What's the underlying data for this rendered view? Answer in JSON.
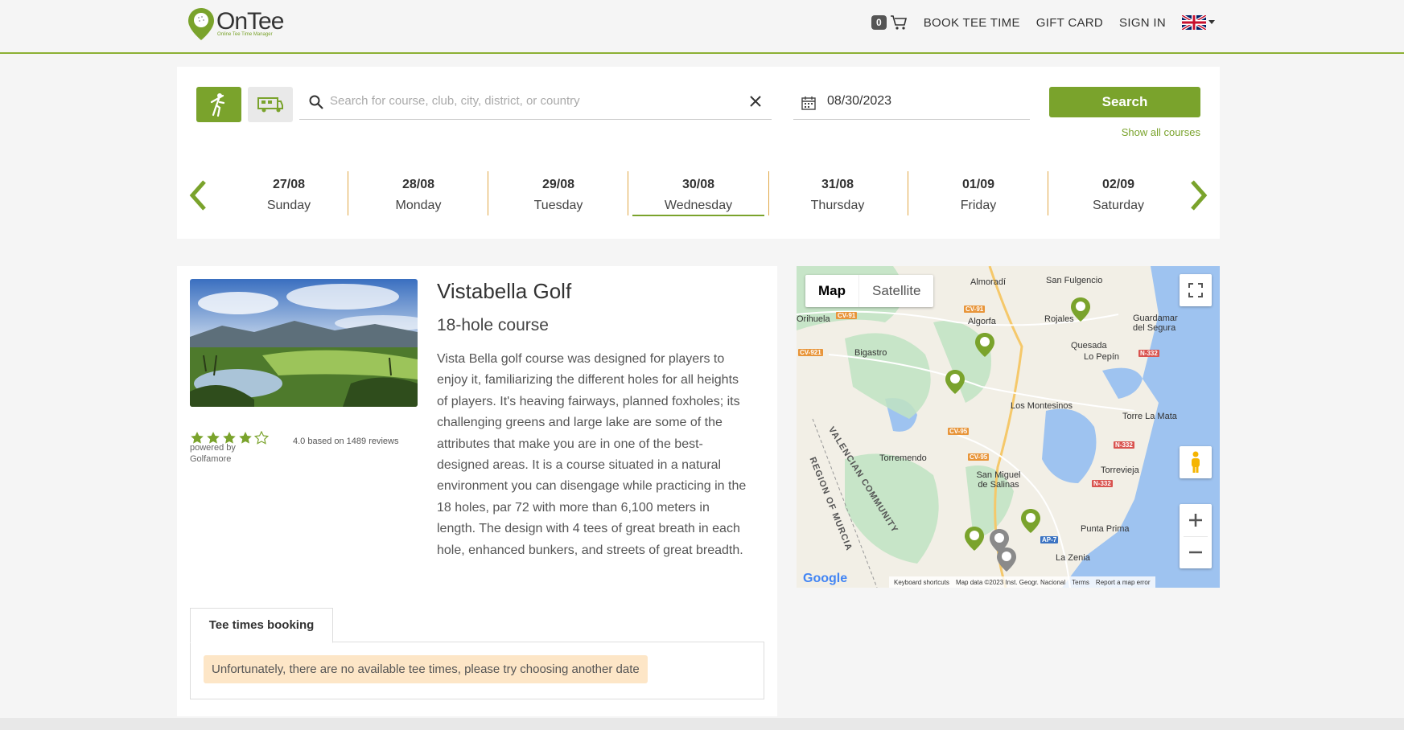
{
  "header": {
    "logo_text": "OnTee",
    "logo_tagline": "Online Tee Time Manager",
    "cart_count": "0",
    "nav": [
      "BOOK TEE TIME",
      "GIFT CARD",
      "SIGN IN"
    ],
    "language_icon": "uk-flag-icon"
  },
  "search": {
    "placeholder": "Search for course, club, city, district, or country",
    "date_value": "08/30/2023",
    "search_label": "Search",
    "show_all_label": "Show all courses"
  },
  "days": [
    {
      "date": "27/08",
      "weekday": "Sunday"
    },
    {
      "date": "28/08",
      "weekday": "Monday"
    },
    {
      "date": "29/08",
      "weekday": "Tuesday"
    },
    {
      "date": "30/08",
      "weekday": "Wednesday"
    },
    {
      "date": "31/08",
      "weekday": "Thursday"
    },
    {
      "date": "01/09",
      "weekday": "Friday"
    },
    {
      "date": "02/09",
      "weekday": "Saturday"
    }
  ],
  "course": {
    "title": "Vistabella Golf",
    "subtitle": "18-hole course",
    "description": "Vista Bella golf course was designed for players to enjoy it, familiarizing the different holes for all heights of players. It's heaving fairways, planned foxholes; its challenging greens and large lake are some of the attributes that make you are in one of the best-designed areas. It is a course situated in a natural environment you can disengage while practicing in the 18 holes, par 72 with more than 6,100 meters in length. The design with 4 tees of great breath in each hole, enhanced bunkers, and streets of great breadth.",
    "rating": 4.0,
    "rating_text": "4.0 based on 1489 reviews",
    "powered_by": "powered by",
    "powered_source": "Golfamore"
  },
  "booking": {
    "tab_label": "Tee times booking",
    "alert": "Unfortunately, there are no available tee times, please try choosing another date"
  },
  "map": {
    "type_map": "Map",
    "type_satellite": "Satellite",
    "labels": [
      "Almoradí",
      "San Fulgencio",
      "Rojales",
      "Guardamar del Segura",
      "Algorfa",
      "Quesada",
      "Lo Pepín",
      "Bigastro",
      "Orihuela",
      "Los Montesinos",
      "Torre La Mata",
      "Torremendo",
      "San Miguel de Salinas",
      "Torrevieja",
      "Punta Prima",
      "La Zenia",
      "VALENCIAN COMMUNITY",
      "REGION OF MURCIA"
    ],
    "roads": [
      "CV-91",
      "CV-91",
      "CV-921",
      "CV-95",
      "CV-95",
      "N-332",
      "N-332",
      "N-332",
      "AP-7"
    ],
    "footer": [
      "Keyboard shortcuts",
      "Map data ©2023 Inst. Geogr. Nacional",
      "Terms",
      "Report a map error"
    ],
    "google_logo": "Google",
    "colors": {
      "water": "#9ec3f0",
      "green": "#bfe3c2",
      "land": "#f2efe6",
      "road": "#f5c86a"
    }
  }
}
